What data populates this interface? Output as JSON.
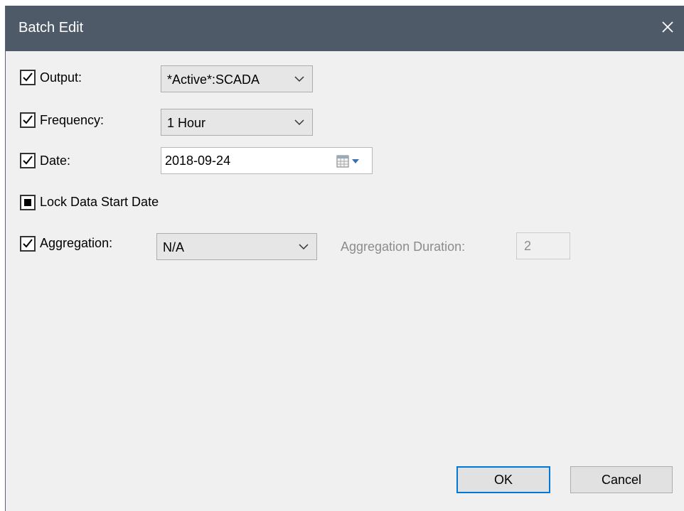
{
  "window": {
    "title": "Batch Edit"
  },
  "form": {
    "output": {
      "label": "Output:",
      "checked": true,
      "value": "*Active*:SCADA"
    },
    "frequency": {
      "label": "Frequency:",
      "checked": true,
      "value": "1 Hour"
    },
    "date": {
      "label": "Date:",
      "checked": true,
      "value": "2018-09-24"
    },
    "lock_start_date": {
      "label": "Lock Data Start Date",
      "state": "indeterminate"
    },
    "aggregation": {
      "label": "Aggregation:",
      "checked": true,
      "value": "N/A",
      "duration_label": "Aggregation Duration:",
      "duration_value": "2"
    }
  },
  "buttons": {
    "ok_label": "OK",
    "cancel_label": "Cancel"
  },
  "colors": {
    "titlebar": "#4f5a68",
    "dialog_bg": "#f0f0f0",
    "default_button_border": "#0078d7"
  },
  "icons": {
    "close": "close-icon",
    "check": "checkmark-icon",
    "chevron": "chevron-down-icon",
    "calendar": "calendar-icon"
  }
}
